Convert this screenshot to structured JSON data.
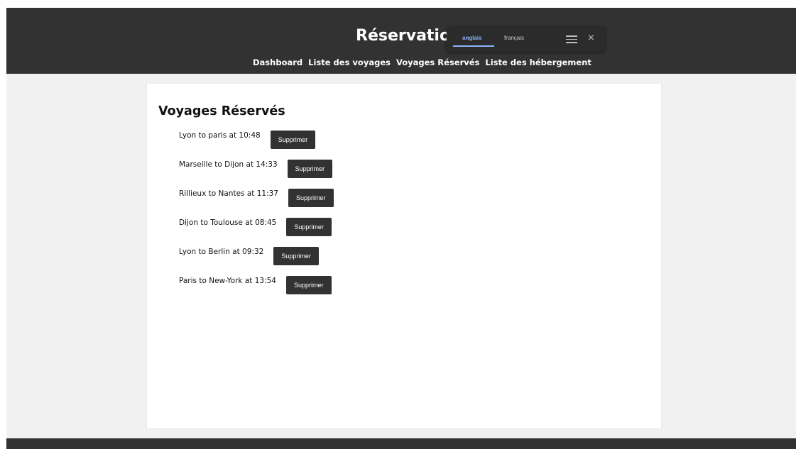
{
  "header": {
    "title": "Réservation",
    "nav": [
      "Dashboard",
      "Liste des voyages",
      "Voyages Réservés",
      "Liste des hébergement"
    ]
  },
  "translate": {
    "languages": [
      "anglais",
      "français"
    ],
    "active_language": "anglais",
    "menu_icon": "hamburger-menu-icon",
    "close_icon": "close-icon",
    "close_glyph": "×"
  },
  "main": {
    "heading": "Voyages Réservés",
    "delete_label": "Supprimer",
    "trips": [
      "Lyon to paris at 10:48",
      "Marseille to Dijon at 14:33",
      "Rillieux to Nantes at 11:37",
      "Dijon to Toulouse at 08:45",
      "Lyon to Berlin at 09:32",
      "Paris to New-York at 13:54"
    ]
  },
  "colors": {
    "header_bg": "#323232",
    "page_bg": "#f1f1f1",
    "accent_blue": "#8ab4f8"
  }
}
